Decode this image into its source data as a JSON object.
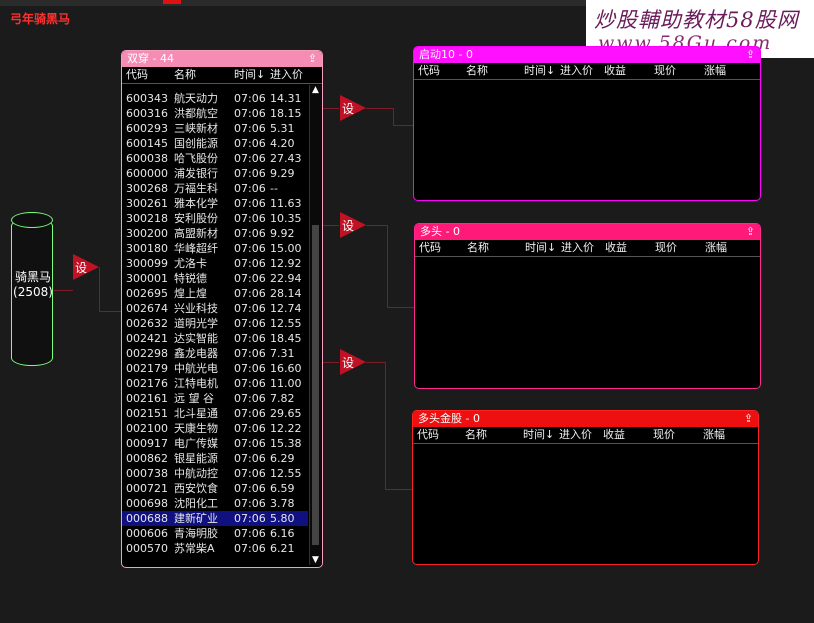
{
  "app_title": "弓年骑黑马",
  "watermark": {
    "line1": "炒股輔助教材58股网",
    "line2": "www.58Gu.com"
  },
  "horse": {
    "name": "骑黑马",
    "count": "(2508)"
  },
  "set_label": "设",
  "main_panel": {
    "title": "双穿 - 44",
    "arrow": "⇪",
    "columns": [
      "代码",
      "名称",
      "时间↓",
      "进入价"
    ],
    "scroll_up": "▲",
    "scroll_down": "▼",
    "rows": [
      [
        "600343",
        "航天动力",
        "07:06",
        "14.31"
      ],
      [
        "600316",
        "洪都航空",
        "07:06",
        "18.15"
      ],
      [
        "600293",
        "三峡新材",
        "07:06",
        "5.31"
      ],
      [
        "600145",
        "国创能源",
        "07:06",
        "4.20"
      ],
      [
        "600038",
        "哈飞股份",
        "07:06",
        "27.43"
      ],
      [
        "600000",
        "浦发银行",
        "07:06",
        "9.29"
      ],
      [
        "300268",
        "万福生科",
        "07:06",
        "--"
      ],
      [
        "300261",
        "雅本化学",
        "07:06",
        "11.63"
      ],
      [
        "300218",
        "安利股份",
        "07:06",
        "10.35"
      ],
      [
        "300200",
        "高盟新材",
        "07:06",
        "9.92"
      ],
      [
        "300180",
        "华峰超纤",
        "07:06",
        "15.00"
      ],
      [
        "300099",
        "尤洛卡",
        "07:06",
        "12.92"
      ],
      [
        "300001",
        "特锐德",
        "07:06",
        "22.94"
      ],
      [
        "002695",
        "煌上煌",
        "07:06",
        "28.14"
      ],
      [
        "002674",
        "兴业科技",
        "07:06",
        "12.74"
      ],
      [
        "002632",
        "道明光学",
        "07:06",
        "12.55"
      ],
      [
        "002421",
        "达实智能",
        "07:06",
        "18.45"
      ],
      [
        "002298",
        "鑫龙电器",
        "07:06",
        "7.31"
      ],
      [
        "002179",
        "中航光电",
        "07:06",
        "16.60"
      ],
      [
        "002176",
        "江特电机",
        "07:06",
        "11.00"
      ],
      [
        "002161",
        "远 望 谷",
        "07:06",
        "7.82"
      ],
      [
        "002151",
        "北斗星通",
        "07:06",
        "29.65"
      ],
      [
        "002100",
        "天康生物",
        "07:06",
        "12.22"
      ],
      [
        "000917",
        "电广传媒",
        "07:06",
        "15.38"
      ],
      [
        "000862",
        "银星能源",
        "07:06",
        "6.29"
      ],
      [
        "000738",
        "中航动控",
        "07:06",
        "12.55"
      ],
      [
        "000721",
        "西安饮食",
        "07:06",
        "6.59"
      ],
      [
        "000698",
        "沈阳化工",
        "07:06",
        "3.78"
      ],
      [
        "000688",
        "建新矿业",
        "07:06",
        "5.80"
      ],
      [
        "000606",
        "青海明胶",
        "07:06",
        "6.16"
      ],
      [
        "000570",
        "苏常柴A",
        "07:06",
        "6.21"
      ]
    ],
    "selected_row": 28
  },
  "panels": [
    {
      "title": "启动10 - 0",
      "arrow": "⇪"
    },
    {
      "title": "多头 - 0",
      "arrow": "⇪"
    },
    {
      "title": "多头金股 - 0",
      "arrow": "⇪"
    }
  ],
  "right_columns": [
    "代码",
    "名称",
    "时间↓",
    "进入价",
    "收益",
    "现价",
    "涨幅"
  ]
}
